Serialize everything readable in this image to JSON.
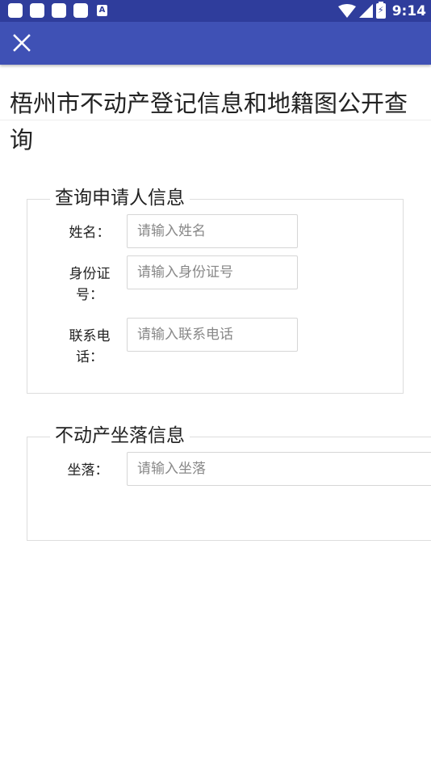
{
  "status_bar": {
    "time": "9:14",
    "notification_a_label": "A",
    "battery_glyph": "⚡"
  },
  "app_bar": {
    "close_glyph": "✕"
  },
  "page": {
    "title": "梧州市不动产登记信息和地籍图公开查询"
  },
  "applicant_section": {
    "legend": "查询申请人信息",
    "name_label": "姓名：",
    "name_placeholder": "请输入姓名",
    "id_label": "身份证号：",
    "id_placeholder": "请输入身份证号",
    "phone_label": "联系电话：",
    "phone_placeholder": "请输入联系电话"
  },
  "property_section": {
    "legend": "不动产坐落信息",
    "location_label": "坐落：",
    "location_placeholder": "请输入坐落"
  }
}
